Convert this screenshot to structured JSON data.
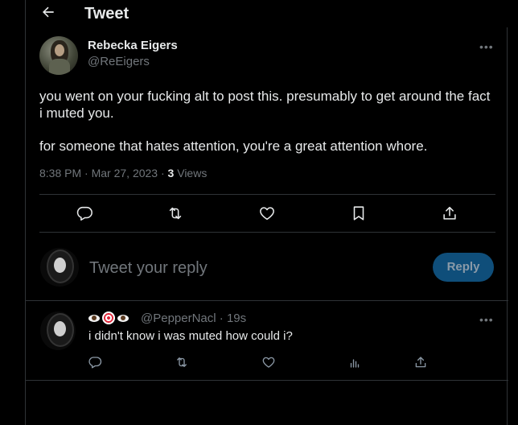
{
  "header": {
    "title": "Tweet"
  },
  "tweet": {
    "author_name": "Rebecka Eigers",
    "author_handle": "@ReEigers",
    "paragraphs": [
      "you went on your fucking alt to post this. presumably to get around the fact i muted you.",
      "for someone that hates attention, you're a great attention whore."
    ],
    "time": "8:38 PM",
    "date": "Mar 27, 2023",
    "views_count": "3",
    "views_label": "Views"
  },
  "reply_box": {
    "placeholder": "Tweet your reply",
    "button": "Reply"
  },
  "reply_tweet": {
    "handle": "@PepperNacl",
    "age": "19s",
    "text": "i didn't know i was muted how could i?"
  },
  "icons": {
    "back": "arrow-left-icon",
    "more": "more-dots-icon",
    "reply": "reply-bubble-icon",
    "retweet": "retweet-icon",
    "like": "heart-icon",
    "bookmark": "bookmark-icon",
    "share": "share-icon",
    "analytics": "analytics-icon"
  },
  "colors": {
    "background": "#000000",
    "text": "#e7e9ea",
    "muted": "#71767b",
    "border": "#2f3336",
    "reply_button": "#0f4e7a"
  }
}
